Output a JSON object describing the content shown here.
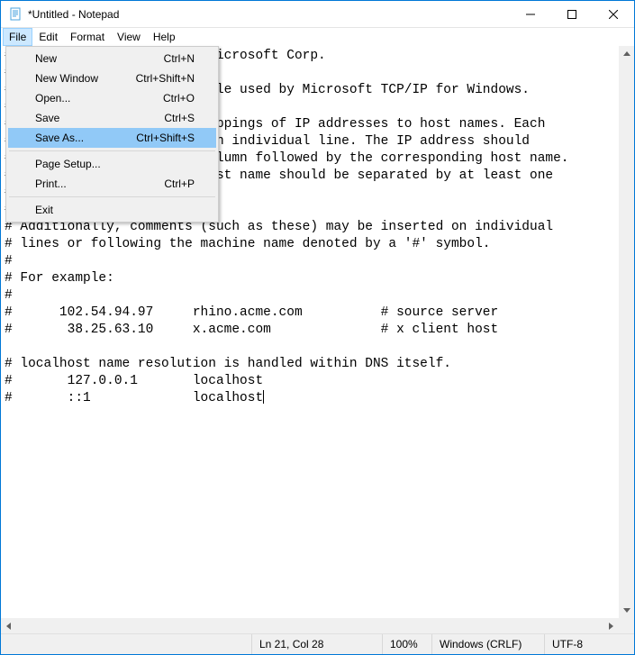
{
  "window": {
    "title": "*Untitled - Notepad"
  },
  "menubar": {
    "items": [
      "File",
      "Edit",
      "Format",
      "View",
      "Help"
    ],
    "active_index": 0
  },
  "file_menu": {
    "items": [
      {
        "label": "New",
        "shortcut": "Ctrl+N"
      },
      {
        "label": "New Window",
        "shortcut": "Ctrl+Shift+N"
      },
      {
        "label": "Open...",
        "shortcut": "Ctrl+O"
      },
      {
        "label": "Save",
        "shortcut": "Ctrl+S"
      },
      {
        "label": "Save As...",
        "shortcut": "Ctrl+Shift+S",
        "highlight": true
      },
      {
        "separator": true
      },
      {
        "label": "Page Setup...",
        "shortcut": ""
      },
      {
        "label": "Print...",
        "shortcut": "Ctrl+P"
      },
      {
        "separator": true
      },
      {
        "label": "Exit",
        "shortcut": ""
      }
    ]
  },
  "editor": {
    "text": "# Copyright (c) 1993-2009 Microsoft Corp.\n#\n# This is a sample HOSTS file used by Microsoft TCP/IP for Windows.\n#\n# This file contains the mappings of IP addresses to host names. Each\n# entry should be kept on an individual line. The IP address should\n# be placed in the first column followed by the corresponding host name.\n# The IP address and the host name should be separated by at least one\n# space.\n#\n# Additionally, comments (such as these) may be inserted on individual\n# lines or following the machine name denoted by a '#' symbol.\n#\n# For example:\n#\n#      102.54.94.97     rhino.acme.com          # source server\n#       38.25.63.10     x.acme.com              # x client host\n\n# localhost name resolution is handled within DNS itself.\n#\t127.0.0.1       localhost\n#\t::1             localhost"
  },
  "statusbar": {
    "position": "Ln 21, Col 28",
    "zoom": "100%",
    "line_ending": "Windows (CRLF)",
    "encoding": "UTF-8"
  }
}
